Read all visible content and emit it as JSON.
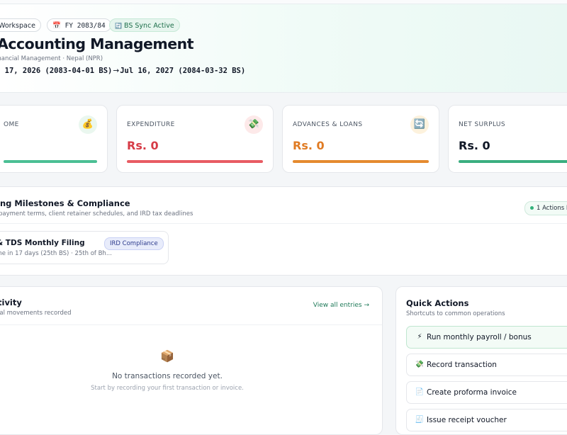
{
  "header": {
    "workspace_chip": "Workspace",
    "fy_chip": "FY 2083/84",
    "sync_chip": "BS Sync Active",
    "title": "Accounting Management",
    "subtitle": "inancial Management · Nepal (NPR)",
    "date_start": "l 17, 2026 (2083-04-01 BS)",
    "date_arrow": "→",
    "date_end": "Jul 16, 2027 (2084-03-32 BS)",
    "icons": {
      "calendar": "calendar-icon",
      "sync": "sync-icon"
    }
  },
  "summary_cards": [
    {
      "label": "OME",
      "value": "",
      "icon": "💰",
      "icon_name": "money-bag-icon",
      "icon_bg": "#eaf7ef",
      "bar_color": "#4bbf94"
    },
    {
      "label": "EXPENDITURE",
      "value": "Rs. 0",
      "icon": "💸",
      "icon_name": "money-wings-icon",
      "icon_bg": "#fde9e9",
      "value_color": "#d63b46",
      "bar_color": "#e85c63"
    },
    {
      "label": "ADVANCES & LOANS",
      "value": "Rs. 0",
      "icon": "🔄",
      "icon_name": "refresh-icon",
      "icon_bg": "#fdf2dd",
      "value_color": "#e07b23",
      "bar_color": "#e58a2f"
    },
    {
      "label": "NET SURPLUS",
      "value": "Rs. 0",
      "icon": "",
      "icon_name": "",
      "value_color": "#111827",
      "bar_color": "#3aae80"
    }
  ],
  "milestones": {
    "title": "ing Milestones & Compliance",
    "subtitle": "payment terms, client retainer schedules, and IRD tax deadlines",
    "actions_badge": "1 Actions P",
    "task": {
      "title": "& TDS Monthly Filing",
      "detail": "ine in 17 days (25th BS) · 25th of Bh...",
      "tag": "IRD Compliance"
    }
  },
  "activity": {
    "title": "tivity",
    "subtitle": "ial movements recorded",
    "view_all": "View all entries →",
    "empty_icon": "📦",
    "empty_title": "No transactions recorded yet.",
    "empty_subtitle": "Start by recording your first transaction or invoice."
  },
  "quick_actions": {
    "title": "Quick Actions",
    "subtitle": "Shortcuts to common operations",
    "items": [
      {
        "icon": "⚡",
        "icon_name": "lightning-icon",
        "label": "Run monthly payroll / bonus"
      },
      {
        "icon": "💸",
        "icon_name": "money-wings-icon",
        "label": "Record transaction"
      },
      {
        "icon": "📄",
        "icon_name": "document-icon",
        "label": "Create proforma invoice"
      },
      {
        "icon": "🧾",
        "icon_name": "receipt-icon",
        "label": "Issue receipt voucher"
      }
    ]
  }
}
